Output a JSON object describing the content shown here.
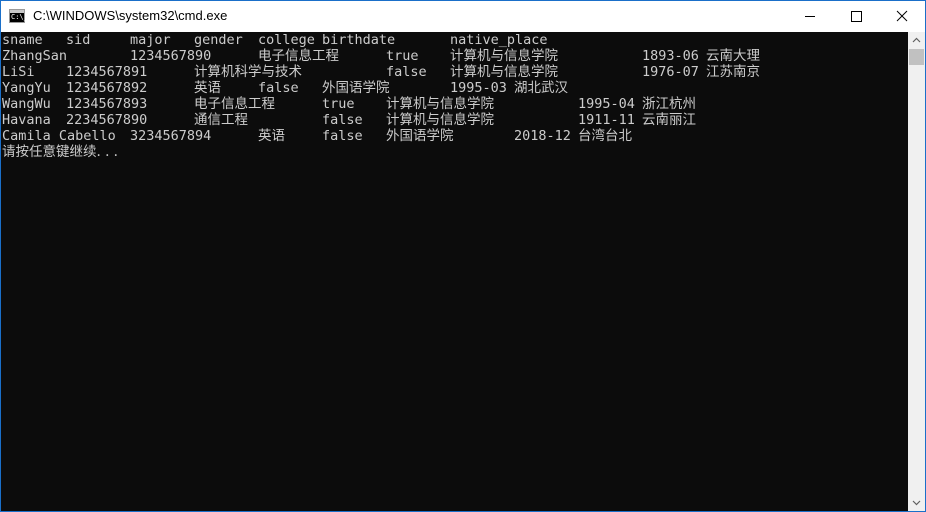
{
  "window": {
    "title": "C:\\WINDOWS\\system32\\cmd.exe",
    "icon_prompt": "C:\\_"
  },
  "console": {
    "header": [
      "sname",
      "sid",
      "major",
      "gender",
      "college",
      "birthdate",
      "native_place"
    ],
    "rows": [
      [
        "ZhangSan",
        "1234567890",
        "电子信息工程",
        "true",
        "计算机与信息学院",
        "1893-06",
        "云南大理"
      ],
      [
        "LiSi",
        "1234567891",
        "计算机科学与技术",
        "false",
        "计算机与信息学院",
        "1976-07",
        "江苏南京"
      ],
      [
        "YangYu",
        "1234567892",
        "英语",
        "false",
        "外国语学院",
        "1995-03",
        "湖北武汉"
      ],
      [
        "WangWu",
        "1234567893",
        "电子信息工程",
        "true",
        "计算机与信息学院",
        "1995-04",
        "浙江杭州"
      ],
      [
        "Havana",
        "2234567890",
        "通信工程",
        "false",
        "计算机与信息学院",
        "1911-11",
        "云南丽江"
      ],
      [
        "Camila Cabello",
        "3234567894",
        "英语",
        "false",
        "外国语学院",
        "2018-12",
        "台湾台北"
      ]
    ],
    "footer": "请按任意键继续. . ."
  }
}
